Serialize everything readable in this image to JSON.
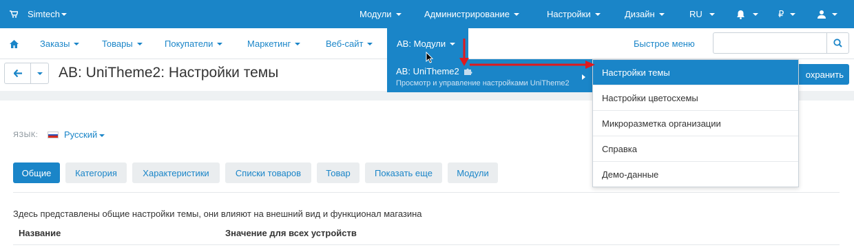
{
  "topbar": {
    "brand": "Simtech",
    "menus": [
      "Модули",
      "Администрирование",
      "Настройки",
      "Дизайн",
      "RU"
    ],
    "currency": "₽"
  },
  "nav": {
    "items": [
      "Заказы",
      "Товары",
      "Покупатели",
      "Маркетинг",
      "Веб-сайт",
      "AB: Модули"
    ],
    "quick_menu": "Быстрое меню",
    "search_placeholder": ""
  },
  "page": {
    "title": "AB: UniTheme2: Настройки темы",
    "save_label": "охранить"
  },
  "dropdown": {
    "addon_name": "AB: UniTheme2",
    "addon_desc": "Просмотр и управление настройками UniTheme2",
    "submenu": [
      "Настройки темы",
      "Настройки цветосхемы",
      "Микроразметка организации",
      "Справка",
      "Демо-данные"
    ],
    "highlighted_index": 0
  },
  "content": {
    "lang_label": "ЯЗЫК:",
    "lang_value": "Русский",
    "tabs": [
      "Общие",
      "Категория",
      "Характеристики",
      "Списки товаров",
      "Товар",
      "Показать еще",
      "Модули"
    ],
    "active_tab": 0,
    "description": "Здесь представлены общие настройки темы, они влияют на внешний вид и функционал магазина",
    "col_name": "Название",
    "col_value": "Значение для всех устройств"
  },
  "colors": {
    "accent": "#1a85c8",
    "annotation_arrow": "#e0191e"
  }
}
